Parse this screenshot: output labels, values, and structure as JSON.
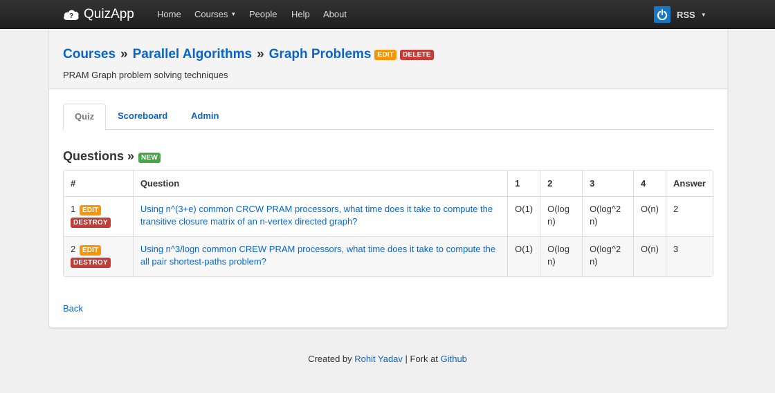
{
  "navbar": {
    "brand": "QuizApp",
    "items": [
      {
        "label": "Home"
      },
      {
        "label": "Courses"
      },
      {
        "label": "People"
      },
      {
        "label": "Help"
      },
      {
        "label": "About"
      }
    ],
    "user": "RSS"
  },
  "header": {
    "crumbs": [
      "Courses",
      "Parallel Algorithms",
      "Graph Problems"
    ],
    "separator": "»",
    "edit_label": "EDIT",
    "delete_label": "DELETE",
    "subtitle": "PRAM Graph problem solving techniques"
  },
  "tabs": [
    {
      "label": "Quiz",
      "active": true
    },
    {
      "label": "Scoreboard"
    },
    {
      "label": "Admin"
    }
  ],
  "questions": {
    "title": "Questions »",
    "new_label": "NEW",
    "columns": [
      "#",
      "Question",
      "1",
      "2",
      "3",
      "4",
      "Answer"
    ],
    "edit_label": "EDIT",
    "destroy_label": "DESTROY",
    "rows": [
      {
        "num": "1",
        "question": "Using n^(3+e) common CRCW PRAM processors, what time does it take to compute the transitive closure matrix of an n-vertex directed graph?",
        "o1": "O(1)",
        "o2": "O(log n)",
        "o3": "O(log^2 n)",
        "o4": "O(n)",
        "answer": "2"
      },
      {
        "num": "2",
        "question": "Using n^3/logn common CREW PRAM processors, what time does it take to compute the all pair shortest-paths problem?",
        "o1": "O(1)",
        "o2": "O(log n)",
        "o3": "O(log^2 n)",
        "o4": "O(n)",
        "answer": "3"
      }
    ]
  },
  "back_label": "Back",
  "footer": {
    "created_by": "Created by",
    "author": "Rohit Yadav",
    "fork_text": "| Fork at",
    "github": "Github"
  },
  "colors": {
    "link": "#0a64c8",
    "edit_badge": "#f89406",
    "delete_badge": "#c33c36",
    "new_badge": "#46a546",
    "navbar": "#2a2a2a"
  },
  "icons": [
    "cloud-question-icon",
    "power-icon",
    "caret-down-icon"
  ]
}
